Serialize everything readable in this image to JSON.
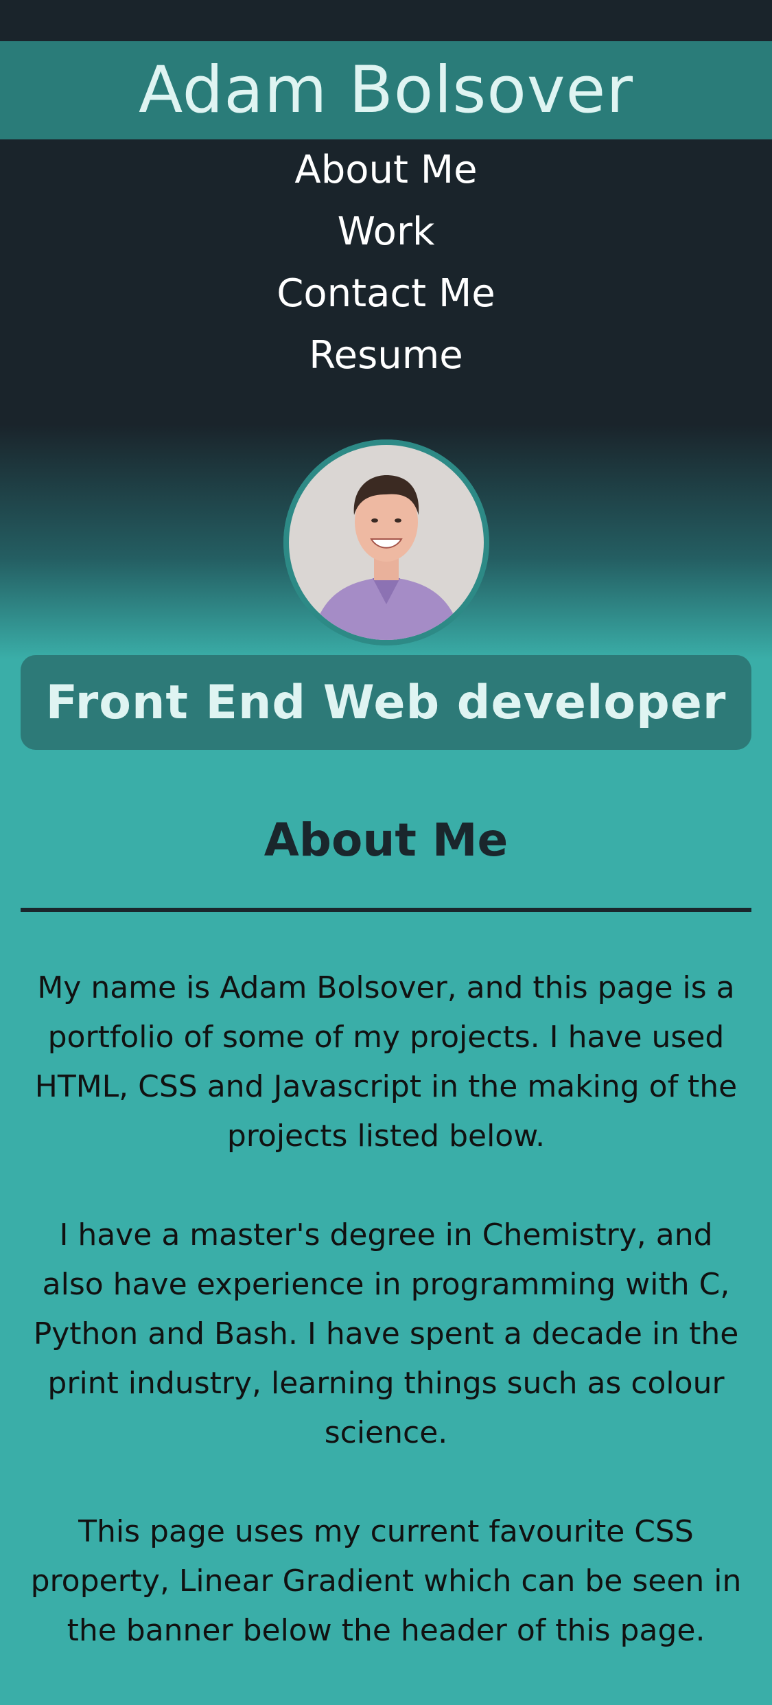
{
  "header": {
    "title": "Adam Bolsover"
  },
  "nav": {
    "items": [
      {
        "label": "About Me"
      },
      {
        "label": "Work"
      },
      {
        "label": "Contact Me"
      },
      {
        "label": "Resume"
      }
    ]
  },
  "hero": {
    "role": "Front End Web developer"
  },
  "about": {
    "heading": "About Me",
    "paragraphs": [
      "My name is Adam Bolsover, and this page is a portfolio of some of my projects. I have used HTML, CSS and Javascript in the making of the projects listed below.",
      "I have a master's degree in Chemistry, and also have experience in programming with C, Python and Bash. I have spent a decade in the print industry, learning things such as colour science.",
      "This page uses my current favourite CSS property, Linear Gradient which can be seen in the banner below the header of this page."
    ]
  },
  "colors": {
    "header_bg": "#2a7c79",
    "dark_bg": "#1a242b",
    "page_bg": "#3aaea8",
    "heading_text": "#dff4f2"
  }
}
